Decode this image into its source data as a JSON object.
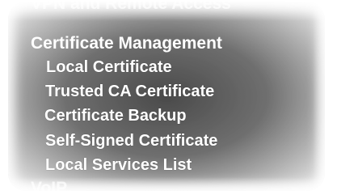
{
  "menu": {
    "previous_section": "VPN and Remote Access",
    "current_section": "Certificate Management",
    "sub_items": [
      {
        "label": "Local Certificate"
      },
      {
        "label": "Trusted CA Certificate"
      },
      {
        "label": "Certificate Backup"
      },
      {
        "label": "Self-Signed Certificate"
      },
      {
        "label": "Local Services List"
      }
    ],
    "next_section": "VoIP"
  }
}
